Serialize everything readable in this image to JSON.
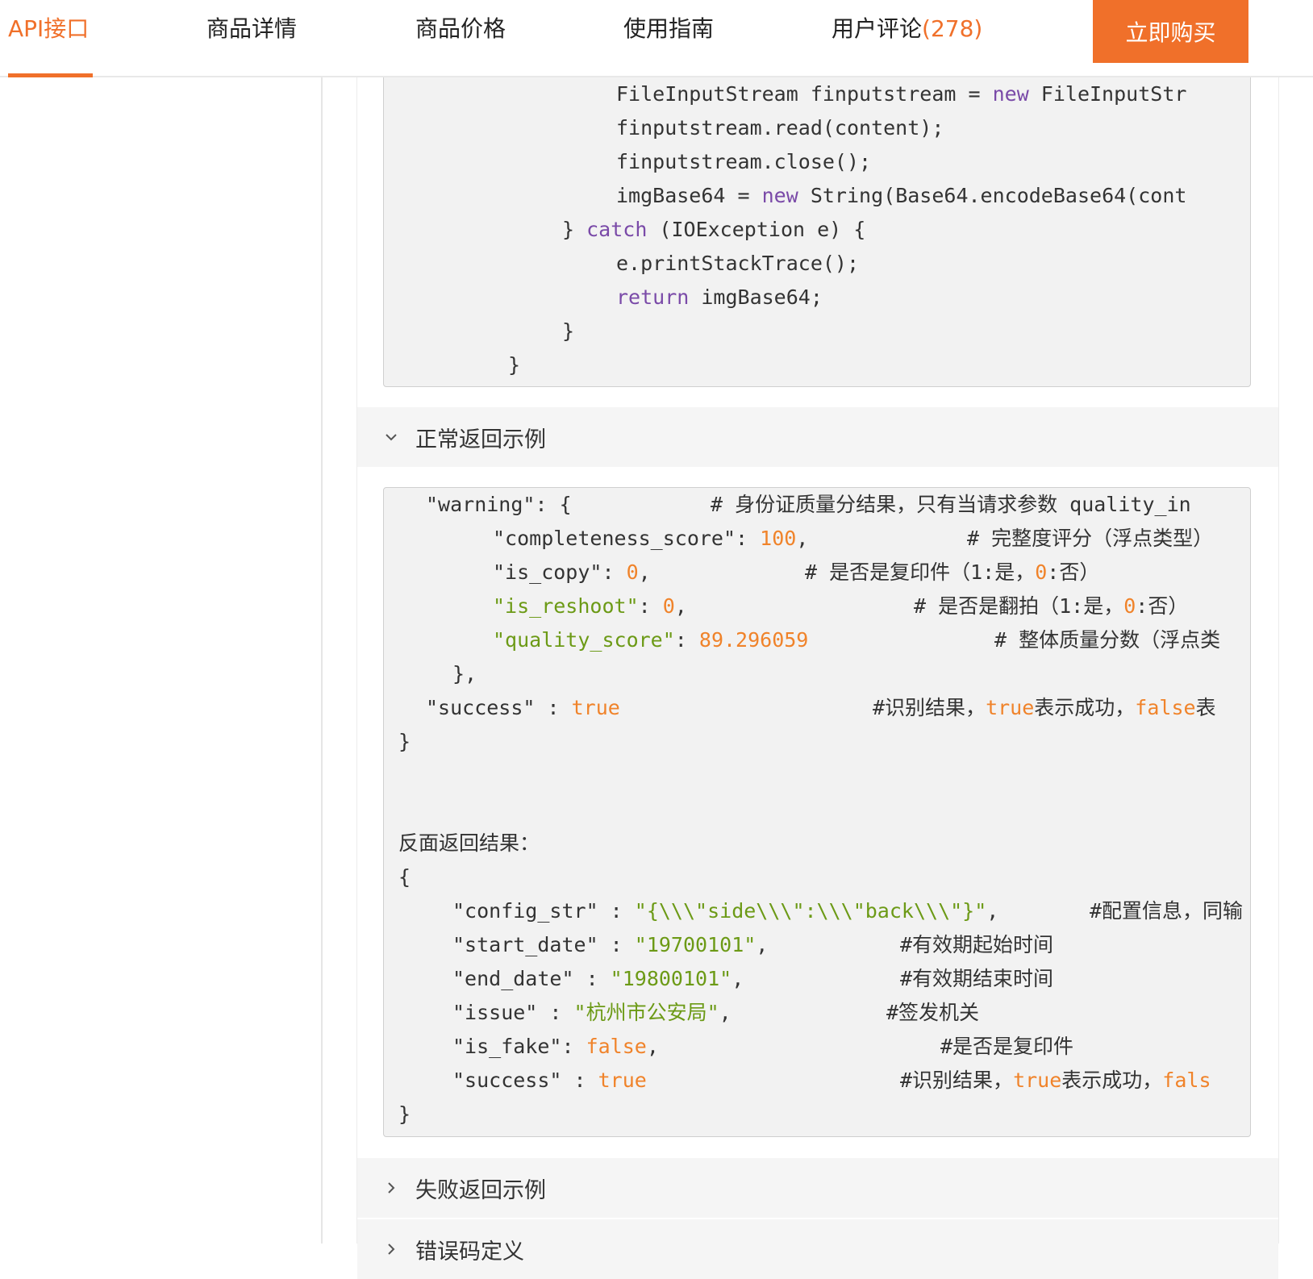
{
  "nav": {
    "tabs": [
      {
        "label": "API接口"
      },
      {
        "label": "商品详情"
      },
      {
        "label": "商品价格"
      },
      {
        "label": "使用指南"
      },
      {
        "label": "用户评论",
        "count": "(278)"
      }
    ],
    "buy_label": "立即购买"
  },
  "colors": {
    "accent": "#f0702a",
    "keyword": "#7a4aa8",
    "number": "#f0832a",
    "string": "#6c9a16"
  },
  "code_top": {
    "lines": [
      "FileInputStream finputstream = new FileInputStr",
      "finputstream.read(content);",
      "finputstream.close();",
      "imgBase64 = new String(Base64.encodeBase64(cont",
      "} catch (IOException e) {",
      "e.printStackTrace();",
      "return imgBase64;",
      "}",
      "}"
    ]
  },
  "sections": {
    "normal": "正常返回示例",
    "fail": "失败返回示例",
    "error": "错误码定义"
  },
  "code_main": {
    "w1": "\"warning\": {",
    "w1c": "# 身份证质量分结果，只有当请求参数 quality_in",
    "w2k": "\"completeness_score\": ",
    "w2v": "100",
    "w2c": "# 完整度评分（浮点类型）",
    "w3k": "\"is_copy\": ",
    "w3v": "0",
    "w3c1": "# 是否是复印件（1:是，",
    "w3c2": "0",
    "w3c3": ":否）",
    "w4k": "\"is_reshoot\"",
    "w4v": "0",
    "w4c1": "# 是否是翻拍（1:是，",
    "w4c2": "0",
    "w4c3": ":否）",
    "w5k": "\"quality_score\"",
    "w5v": "89.296059",
    "w5c": "# 整体质量分数（浮点类",
    "w6": "},",
    "s1k": "\"success\" : ",
    "s1v": "true",
    "s1c1": "#识别结果，",
    "s1c2": "true",
    "s1c3": "表示成功，",
    "s1c4": "false",
    "s1c5": "表",
    "close1": "}",
    "back_title": "反面返回结果：",
    "open2": "{",
    "b1k": "\"config_str\" : ",
    "b1v": "\"{\\\\\\\"side\\\\\\\":\\\\\\\"back\\\\\\\"}\"",
    "b1c": "#配置信息，同输",
    "b2k": "\"start_date\" : ",
    "b2v": "\"19700101\"",
    "b2c": "#有效期起始时间",
    "b3k": "\"end_date\" : ",
    "b3v": "\"19800101\"",
    "b3c": "#有效期结束时间",
    "b4k": "\"issue\" : ",
    "b4v": "\"杭州市公安局\"",
    "b4c": "#签发机关",
    "b5k": "\"is_fake\": ",
    "b5v": "false",
    "b5c": "#是否是复印件",
    "b6k": "\"success\" : ",
    "b6v": "true",
    "b6c1": "#识别结果，",
    "b6c2": "true",
    "b6c3": "表示成功，",
    "b6c4": "fals",
    "close2": "}"
  }
}
